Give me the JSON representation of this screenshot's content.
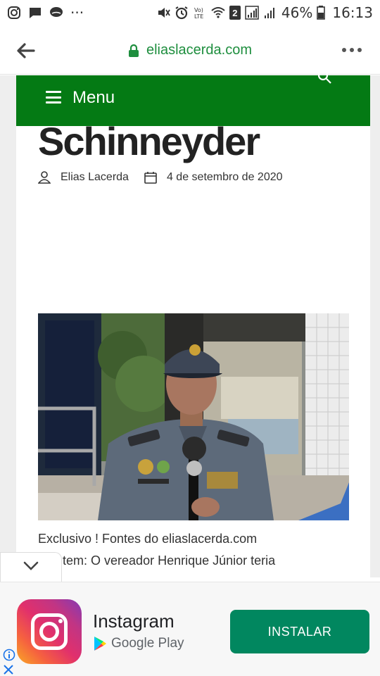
{
  "status_bar": {
    "left_icons": [
      "instagram-icon",
      "message-icon",
      "chat-bubble-icon",
      "more-notifications-icon"
    ],
    "more_label": "···",
    "right_icons": [
      "mute-icon",
      "alarm-icon",
      "volte-icon",
      "wifi-icon",
      "sim2-icon",
      "signal-icon"
    ],
    "sim_label": "2",
    "volte_label": "Vo) LTE",
    "battery": "46%",
    "time": "16:13"
  },
  "browser": {
    "url": "eliaslacerda.com",
    "url_color": "#1e8e3e"
  },
  "site": {
    "menu_label": "Menu",
    "menu_color": "#047a14"
  },
  "article": {
    "headline_visible": "Schinneyder",
    "author": "Elias Lacerda",
    "date": "4 de setembro de 2020",
    "caption_line1": "Exclusivo ! Fontes do eliaslacerda.com",
    "caption_line2": "...antem: O vereador Henrique Júnior teria"
  },
  "ad": {
    "app_name": "Instagram",
    "store": "Google Play",
    "cta": "INSTALAR",
    "cta_color": "#01875f"
  }
}
